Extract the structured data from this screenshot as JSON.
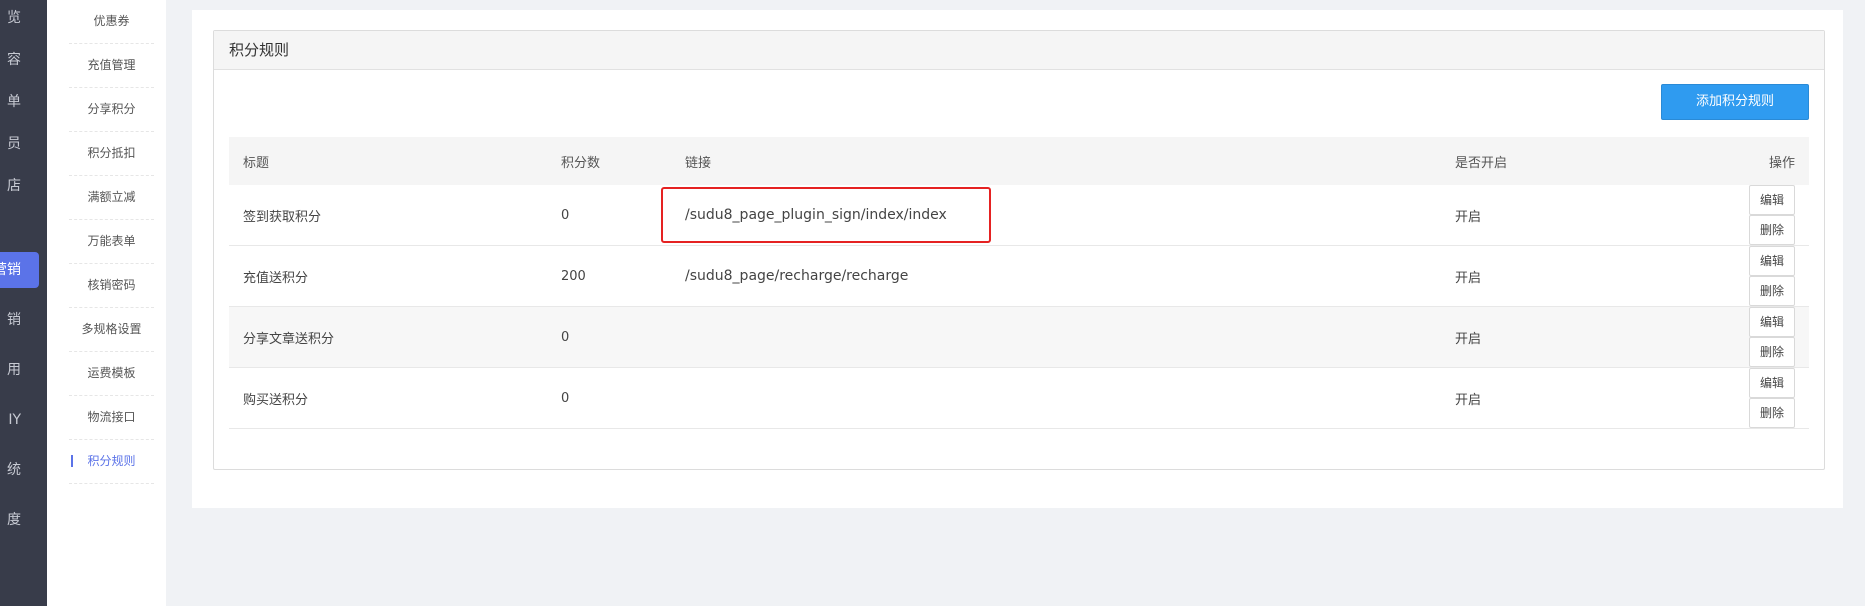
{
  "nav": {
    "items": [
      "览",
      "容",
      "单",
      "员",
      "店",
      "营销",
      "销",
      "用",
      "IY",
      "统",
      "度"
    ],
    "active_index": 5
  },
  "submenu": {
    "items": [
      "优惠券",
      "充值管理",
      "分享积分",
      "积分抵扣",
      "满额立减",
      "万能表单",
      "核销密码",
      "多规格设置",
      "运费模板",
      "物流接口",
      "积分规则"
    ],
    "active_index": 10
  },
  "panel": {
    "title": "积分规则",
    "add_button": "添加积分规则"
  },
  "table": {
    "headers": {
      "title": "标题",
      "points": "积分数",
      "link": "链接",
      "enabled": "是否开启",
      "actions": "操作"
    },
    "rows": [
      {
        "title": "签到获取积分",
        "points": "0",
        "link": "/sudu8_page_plugin_sign/index/index",
        "enabled": "开启",
        "edit": "编辑",
        "delete": "删除"
      },
      {
        "title": "充值送积分",
        "points": "200",
        "link": "/sudu8_page/recharge/recharge",
        "enabled": "开启",
        "edit": "编辑",
        "delete": "删除"
      },
      {
        "title": "分享文章送积分",
        "points": "0",
        "link": "",
        "enabled": "开启",
        "edit": "编辑",
        "delete": "删除"
      },
      {
        "title": "购买送积分",
        "points": "0",
        "link": "",
        "enabled": "开启",
        "edit": "编辑",
        "delete": "删除"
      }
    ]
  },
  "colors": {
    "highlight_box": "#e52222",
    "primary_button": "#2f9bf0",
    "nav_active": "#5b73e8"
  }
}
